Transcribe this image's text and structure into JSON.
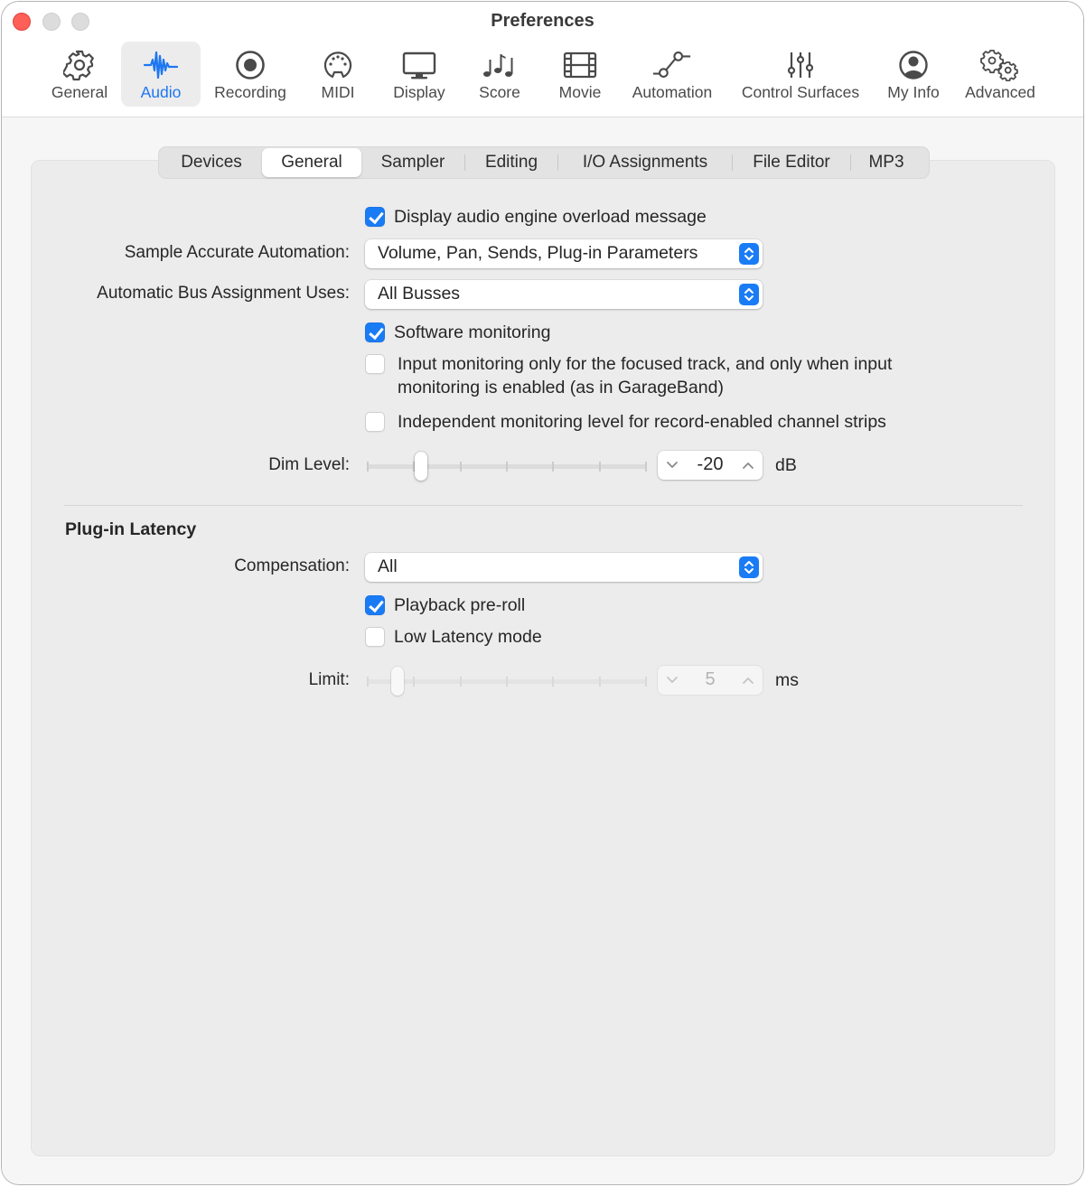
{
  "window": {
    "title": "Preferences"
  },
  "toolbar": {
    "items": [
      {
        "label": "General",
        "icon": "gear-icon"
      },
      {
        "label": "Audio",
        "icon": "waveform-icon",
        "active": true
      },
      {
        "label": "Recording",
        "icon": "record-icon"
      },
      {
        "label": "MIDI",
        "icon": "midi-connector-icon"
      },
      {
        "label": "Display",
        "icon": "monitor-icon"
      },
      {
        "label": "Score",
        "icon": "music-notes-icon"
      },
      {
        "label": "Movie",
        "icon": "film-icon"
      },
      {
        "label": "Automation",
        "icon": "automation-curve-icon"
      },
      {
        "label": "Control Surfaces",
        "icon": "faders-icon"
      },
      {
        "label": "My Info",
        "icon": "person-circle-icon"
      },
      {
        "label": "Advanced",
        "icon": "gears-icon"
      }
    ],
    "accent_color": "#1e77f2"
  },
  "tabs": {
    "items": [
      "Devices",
      "General",
      "Sampler",
      "Editing",
      "I/O Assignments",
      "File Editor",
      "MP3"
    ],
    "selected": "General"
  },
  "general": {
    "display_overload": {
      "label": "Display audio engine overload message",
      "checked": true
    },
    "sample_accurate_automation": {
      "label": "Sample Accurate Automation:",
      "value": "Volume, Pan, Sends, Plug-in Parameters"
    },
    "bus_assignment": {
      "label": "Automatic Bus Assignment Uses:",
      "value": "All Busses"
    },
    "software_monitoring": {
      "label": "Software monitoring",
      "checked": true
    },
    "input_monitoring_focused": {
      "label_line1": "Input monitoring only for the focused track, and only when input",
      "label_line2": "monitoring is enabled (as in GarageBand)",
      "checked": false
    },
    "independent_monitoring": {
      "label": "Independent monitoring level for record-enabled channel strips",
      "checked": false
    },
    "dim_level": {
      "label": "Dim Level:",
      "value": "-20",
      "unit": "dB",
      "slider_fraction": 0.18
    }
  },
  "plugin_latency": {
    "title": "Plug-in Latency",
    "compensation": {
      "label": "Compensation:",
      "value": "All"
    },
    "playback_preroll": {
      "label": "Playback pre-roll",
      "checked": true
    },
    "low_latency_mode": {
      "label": "Low Latency mode",
      "checked": false
    },
    "limit": {
      "label": "Limit:",
      "value": "5",
      "unit": "ms",
      "slider_fraction": 0.09,
      "disabled": true
    }
  },
  "colors": {
    "checkbox_checked": "#1a7cf5",
    "close_button": "#fe5f57"
  }
}
